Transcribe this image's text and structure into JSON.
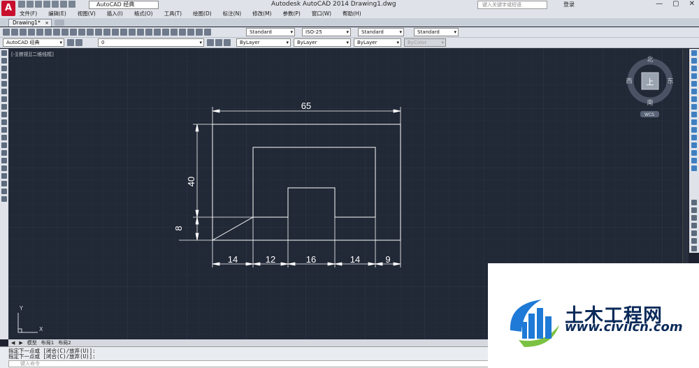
{
  "window": {
    "title": "Autodesk AutoCAD 2014    Drawing1.dwg",
    "app_button": "A",
    "workspace": "AutoCAD 经典",
    "search_placeholder": "键入关键字或短语",
    "login": "登录",
    "min": "—",
    "max": "▢",
    "close": "✕"
  },
  "menu": [
    "文件(F)",
    "编辑(E)",
    "视图(V)",
    "插入(I)",
    "格式(O)",
    "工具(T)",
    "绘图(D)",
    "标注(N)",
    "修改(M)",
    "参数(P)",
    "窗口(W)",
    "帮助(H)"
  ],
  "tabs": {
    "active": "Drawing1*",
    "close": "×"
  },
  "styles": {
    "text_style": "Standard",
    "dim_style": "ISO-25",
    "table_style": "Standard",
    "multileader_style": "Standard"
  },
  "properties": {
    "workspace": "AutoCAD 经典",
    "layer": "0",
    "color": "ByLayer",
    "linetype": "ByLayer",
    "lineweight": "ByLayer",
    "plotstyle": "ByColor"
  },
  "viewport_label": "[-][俯视][二维线框]",
  "viewcube": {
    "north": "北",
    "south": "南",
    "east": "东",
    "west": "西",
    "top": "上",
    "wcs": "WCS"
  },
  "ucs": {
    "x": "X",
    "y": "Y"
  },
  "dimensions": {
    "width_total": "65",
    "height_total": "40",
    "height_chamfer": "8",
    "seg1": "14",
    "seg2": "12",
    "seg3": "16",
    "seg4": "14",
    "seg5": "9"
  },
  "layout_tabs": [
    "◀",
    "▶",
    "模型",
    "布局1",
    "布局2"
  ],
  "command": {
    "line1": "指定下一点或 [闭合(C)/放弃(U)]:",
    "line2": "指定下一点或 [闭合(C)/放弃(U)]:",
    "placeholder": "键入命令"
  },
  "watermark": {
    "title": "土木工程网",
    "url": "www.civilcn.com"
  },
  "colors": {
    "canvas": "#212836",
    "geometry": "#ffffff",
    "brand": "#0b2a5a",
    "accent_blue": "#1e7ad6",
    "accent_green": "#7cc242"
  }
}
